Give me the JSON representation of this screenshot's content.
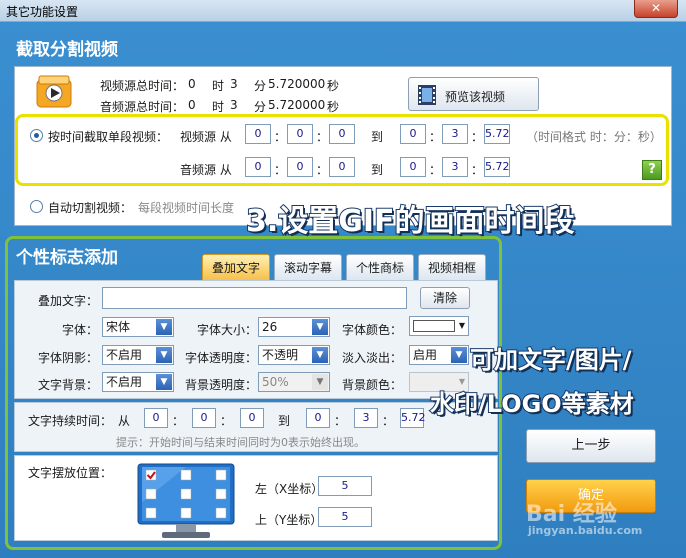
{
  "window": {
    "title": "其它功能设置",
    "close_label": "✕"
  },
  "cut": {
    "title": "截取分割视频",
    "video_total_label": "视频源总时间：",
    "audio_total_label": "音频源总时间：",
    "video_total": {
      "h": "0",
      "h_unit": "时",
      "m": "3",
      "m_unit": "分",
      "s": "5.720000",
      "s_unit": "秒"
    },
    "audio_total": {
      "h": "0",
      "h_unit": "时",
      "m": "3",
      "m_unit": "分",
      "s": "5.720000",
      "s_unit": "秒"
    },
    "preview_button": "预览该视频",
    "single_label": "按时间截取单段视频：",
    "video_src_label": "视频源 从",
    "audio_src_label": "音频源 从",
    "to_label": "到",
    "colon": "：",
    "video_from": [
      "0",
      "0",
      "0"
    ],
    "video_to": [
      "0",
      "3",
      "5.72"
    ],
    "audio_from": [
      "0",
      "0",
      "0"
    ],
    "audio_to": [
      "0",
      "3",
      "5.72"
    ],
    "time_format_hint": "（时间格式 时：分：秒）",
    "help_label": "?",
    "auto_label": "自动切割视频：",
    "segment_label": "每段视频时间长度"
  },
  "logo": {
    "title": "个性标志添加",
    "tabs": [
      "叠加文字",
      "滚动字幕",
      "个性商标",
      "视频相框"
    ],
    "overlay_text_label": "叠加文字：",
    "overlay_text_value": "",
    "clear_button": "清除",
    "font_label": "字体：",
    "font_value": "宋体",
    "font_size_label": "字体大小：",
    "font_size_value": "26",
    "font_color_label": "字体颜色：",
    "shadow_label": "字体阴影：",
    "shadow_value": "不启用",
    "opacity_label": "字体透明度：",
    "opacity_value": "不透明",
    "fade_label": "淡入淡出：",
    "fade_value": "启用",
    "bg_label": "文字背景：",
    "bg_value": "不启用",
    "bg_opacity_label": "背景透明度：",
    "bg_opacity_value": "50%",
    "bg_color_label": "背景颜色：",
    "duration_label": "文字持续时间：",
    "from_label": "从",
    "to_label": "到",
    "colon": "：",
    "dur_from": [
      "0",
      "0",
      "0"
    ],
    "dur_to": [
      "0",
      "3",
      "5.72"
    ],
    "hint": "提示：开始时间与结束时间同时为0表示始终出现。",
    "position_label": "文字摆放位置：",
    "left_label": "左（X坐标）",
    "left_value": "5",
    "top_label": "上（Y坐标）",
    "top_value": "5"
  },
  "buttons": {
    "prev": "上一步",
    "ok": "确定"
  },
  "annotations": {
    "overlay1": "3.设置GIF的画面时间段",
    "overlay2_line1": "可加文字/图片/",
    "overlay2_line2": "水印/LOGO等素材"
  },
  "watermark": {
    "text": "Bai 经验",
    "sub": "jingyan.baidu.com"
  },
  "colors": {
    "accent": "#2f86c8",
    "highlight_yellow": "#e9e200",
    "highlight_green": "#7ec13a",
    "active_tab": "#f7c04a"
  }
}
